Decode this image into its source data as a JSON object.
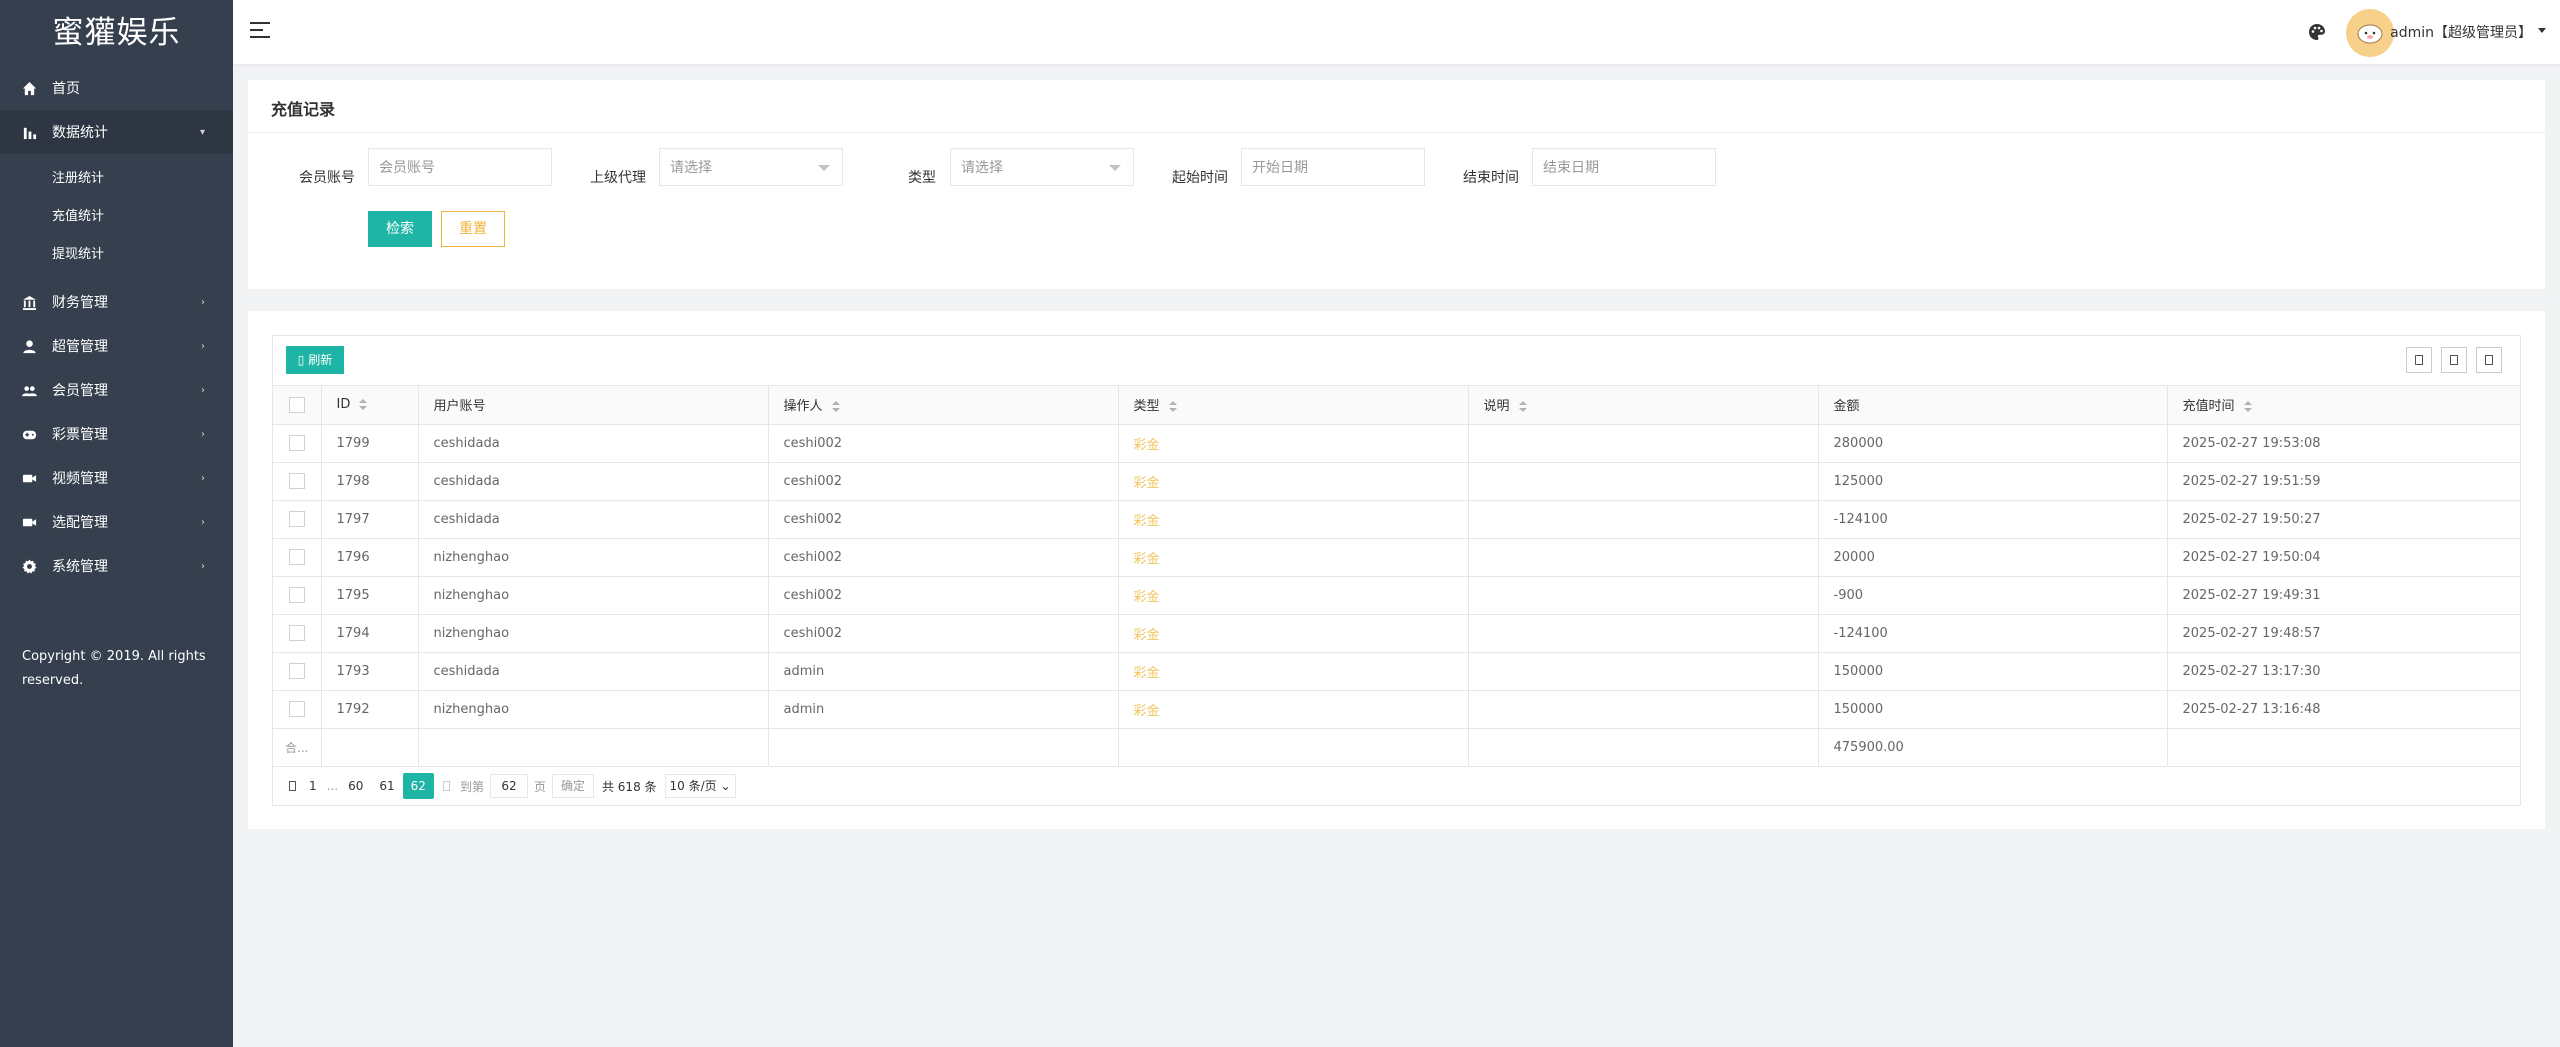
{
  "sidebar": {
    "logo": "蜜獾娱乐",
    "items": [
      {
        "label": "首页",
        "icon": "home-icon"
      },
      {
        "label": "数据统计",
        "icon": "bar-chart-icon",
        "open": true,
        "children": [
          "注册统计",
          "充值统计",
          "提现统计"
        ]
      },
      {
        "label": "财务管理",
        "icon": "bank-icon"
      },
      {
        "label": "超管管理",
        "icon": "user-icon"
      },
      {
        "label": "会员管理",
        "icon": "users-icon"
      },
      {
        "label": "彩票管理",
        "icon": "gamepad-icon"
      },
      {
        "label": "视频管理",
        "icon": "video-icon"
      },
      {
        "label": "选配管理",
        "icon": "camera-icon"
      },
      {
        "label": "系统管理",
        "icon": "gear-icon"
      }
    ],
    "copyright": "Copyright © 2019. All rights reserved."
  },
  "topbar": {
    "admin_label": "admin【超级管理员】"
  },
  "filter": {
    "title": "充值记录",
    "member_label": "会员账号",
    "member_placeholder": "会员账号",
    "agent_label": "上级代理",
    "agent_value": "请选择",
    "type_label": "类型",
    "type_value": "请选择",
    "start_label": "起始时间",
    "start_placeholder": "开始日期",
    "end_label": "结束时间",
    "end_placeholder": "结束日期",
    "search_label": "检索",
    "reset_label": "重置"
  },
  "table": {
    "refresh_label": "刷新",
    "columns": [
      "ID",
      "用户账号",
      "操作人",
      "类型",
      "说明",
      "金额",
      "充值时间"
    ],
    "rows": [
      {
        "id": "1799",
        "user": "ceshidada",
        "operator": "ceshi002",
        "type": "彩金",
        "note": "",
        "amount": "280000",
        "time": "2025-02-27 19:53:08"
      },
      {
        "id": "1798",
        "user": "ceshidada",
        "operator": "ceshi002",
        "type": "彩金",
        "note": "",
        "amount": "125000",
        "time": "2025-02-27 19:51:59"
      },
      {
        "id": "1797",
        "user": "ceshidada",
        "operator": "ceshi002",
        "type": "彩金",
        "note": "",
        "amount": "-124100",
        "time": "2025-02-27 19:50:27"
      },
      {
        "id": "1796",
        "user": "nizhenghao",
        "operator": "ceshi002",
        "type": "彩金",
        "note": "",
        "amount": "20000",
        "time": "2025-02-27 19:50:04"
      },
      {
        "id": "1795",
        "user": "nizhenghao",
        "operator": "ceshi002",
        "type": "彩金",
        "note": "",
        "amount": "-900",
        "time": "2025-02-27 19:49:31"
      },
      {
        "id": "1794",
        "user": "nizhenghao",
        "operator": "ceshi002",
        "type": "彩金",
        "note": "",
        "amount": "-124100",
        "time": "2025-02-27 19:48:57"
      },
      {
        "id": "1793",
        "user": "ceshidada",
        "operator": "admin",
        "type": "彩金",
        "note": "",
        "amount": "150000",
        "time": "2025-02-27 13:17:30"
      },
      {
        "id": "1792",
        "user": "nizhenghao",
        "operator": "admin",
        "type": "彩金",
        "note": "",
        "amount": "150000",
        "time": "2025-02-27 13:16:48"
      }
    ],
    "sum_label": "合...",
    "sum_amount": "475900.00"
  },
  "pager": {
    "pages": [
      "1",
      "...",
      "60",
      "61",
      "62"
    ],
    "current": "62",
    "goto_label": "到第",
    "goto_value": "62",
    "page_unit": "页",
    "confirm_label": "确定",
    "total_label": "共 618 条",
    "limit_label": "10 条/页"
  },
  "colors": {
    "sidebar_bg": "#353f4d",
    "accent": "#1fb5a6",
    "warning": "#f0b43e"
  }
}
